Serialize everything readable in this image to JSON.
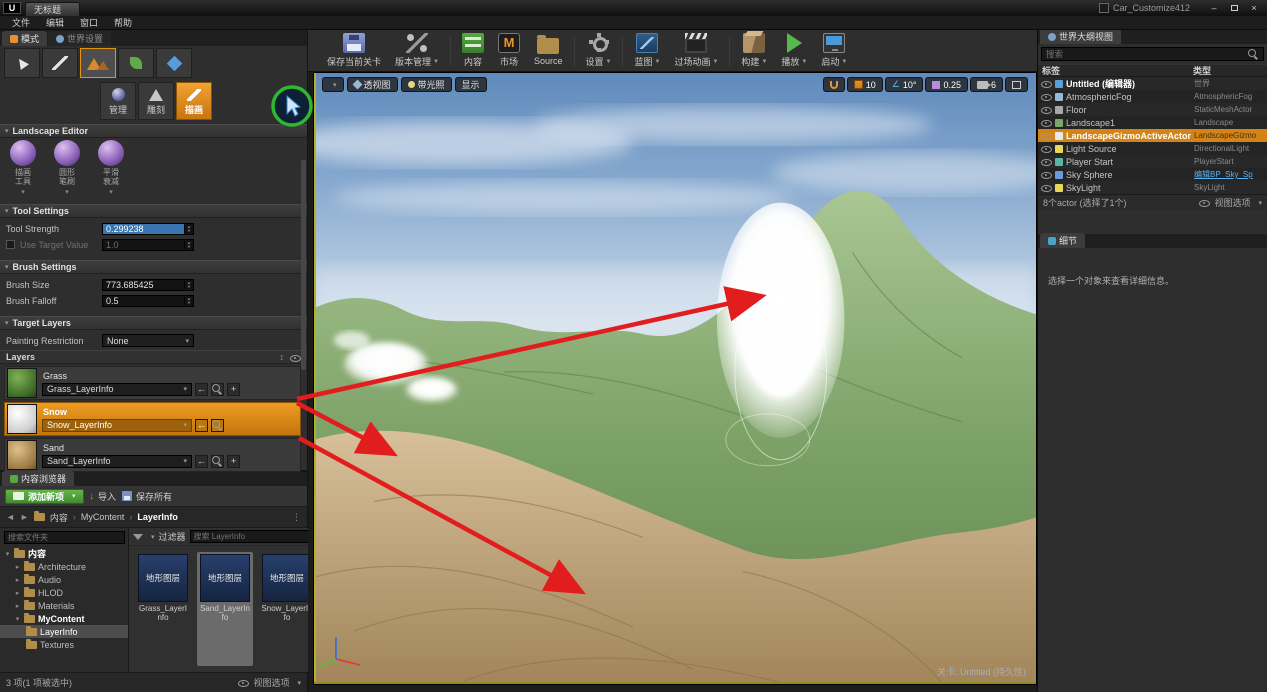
{
  "colors": {
    "accent": "#e8930c",
    "annotation_red": "#e21d1d",
    "annotation_green": "#2eb82e",
    "selection_orange": "#d28416"
  },
  "titlebar": {
    "logo": "U",
    "tab_label": "无标题",
    "window_title": "Car_Customize412"
  },
  "menubar": {
    "items": [
      "文件",
      "编辑",
      "窗口",
      "帮助"
    ]
  },
  "left_panel": {
    "tabs": {
      "modes": "模式",
      "world_settings": "世界设置"
    },
    "mode_buttons": [
      {
        "label": "管理"
      },
      {
        "label": "雕刻"
      },
      {
        "label": "描画"
      }
    ],
    "editor_title": "Landscape Editor",
    "tools": [
      {
        "line1": "描画",
        "line2": "工具"
      },
      {
        "line1": "圆形",
        "line2": "笔刷"
      },
      {
        "line1": "平滑",
        "line2": "衰减"
      }
    ],
    "tool_settings": {
      "header": "Tool Settings",
      "tool_strength_label": "Tool Strength",
      "tool_strength_value": "0.299238",
      "use_target_label": "Use Target Value",
      "use_target_value": "1.0"
    },
    "brush_settings": {
      "header": "Brush Settings",
      "brush_size_label": "Brush Size",
      "brush_size_value": "773.685425",
      "brush_falloff_label": "Brush Falloff",
      "brush_falloff_value": "0.5"
    },
    "target_layers": {
      "header": "Target Layers",
      "painting_restriction_label": "Painting Restriction",
      "painting_restriction_value": "None",
      "layers_header": "Layers"
    },
    "layers": [
      {
        "name": "Grass",
        "info": "Grass_LayerInfo"
      },
      {
        "name": "Snow",
        "info": "Snow_LayerInfo"
      },
      {
        "name": "Sand",
        "info": "Sand_LayerInfo"
      }
    ]
  },
  "content_browser": {
    "tab": "内容浏览器",
    "add_new": "添加新项",
    "import": "导入",
    "save_all": "保存所有",
    "path": {
      "root": "内容",
      "folder": "MyContent",
      "subfolder": "LayerInfo"
    },
    "folder_search_placeholder": "搜索文件夹",
    "tree": [
      {
        "label": "内容"
      },
      {
        "label": "Architecture"
      },
      {
        "label": "Audio"
      },
      {
        "label": "HLOD"
      },
      {
        "label": "Materials"
      },
      {
        "label": "MyContent"
      },
      {
        "label": "LayerInfo"
      },
      {
        "label": "Textures"
      }
    ],
    "filters_label": "过滤器",
    "asset_search_placeholder": "搜索 LayerInfo",
    "assets": [
      {
        "tile": "地形图层",
        "name": "Grass_LayerInfo"
      },
      {
        "tile": "地形图层",
        "name": "Sand_LayerInfo"
      },
      {
        "tile": "地形图层",
        "name": "Snow_LayerInfo"
      }
    ],
    "status": "3 项(1 项被选中)",
    "view_options": "视图选项"
  },
  "toolbar": {
    "buttons": [
      {
        "label": "保存当前关卡"
      },
      {
        "label": "版本管理"
      },
      {
        "label": "内容"
      },
      {
        "label": "市场"
      },
      {
        "label": "Source"
      },
      {
        "label": "设置"
      },
      {
        "label": "蓝图"
      },
      {
        "label": "过场动画"
      },
      {
        "label": "构建"
      },
      {
        "label": "播放"
      },
      {
        "label": "启动"
      }
    ]
  },
  "viewport": {
    "perspective": "透视图",
    "lit": "带光照",
    "show": "显示",
    "grid_snap": "10",
    "angle_snap": "10°",
    "scale_snap": "0.25",
    "camera_speed": "6",
    "level_label": "关卡: Untitled (持久性)"
  },
  "outliner": {
    "tab": "世界大纲视图",
    "search_placeholder": "搜索",
    "columns": {
      "label": "标签",
      "type": "类型"
    },
    "rows": [
      {
        "label": "Untitled (编辑器)",
        "type": "世界"
      },
      {
        "label": "AtmosphericFog",
        "type": "AtmosphericFog"
      },
      {
        "label": "Floor",
        "type": "StaticMeshActor"
      },
      {
        "label": "Landscape1",
        "type": "Landscape"
      },
      {
        "label": "LandscapeGizmoActiveActor",
        "type": "LandscapeGizmo"
      },
      {
        "label": "Light Source",
        "type": "DirectionalLight"
      },
      {
        "label": "Player Start",
        "type": "PlayerStart"
      },
      {
        "label": "Sky Sphere",
        "type": "编辑BP_Sky_Sp"
      },
      {
        "label": "SkyLight",
        "type": "SkyLight"
      }
    ],
    "footer": "8个actor (选择了1个)",
    "view_options": "视图选项"
  },
  "details": {
    "tab": "细节",
    "empty_text": "选择一个对象来查看详细信息。"
  }
}
